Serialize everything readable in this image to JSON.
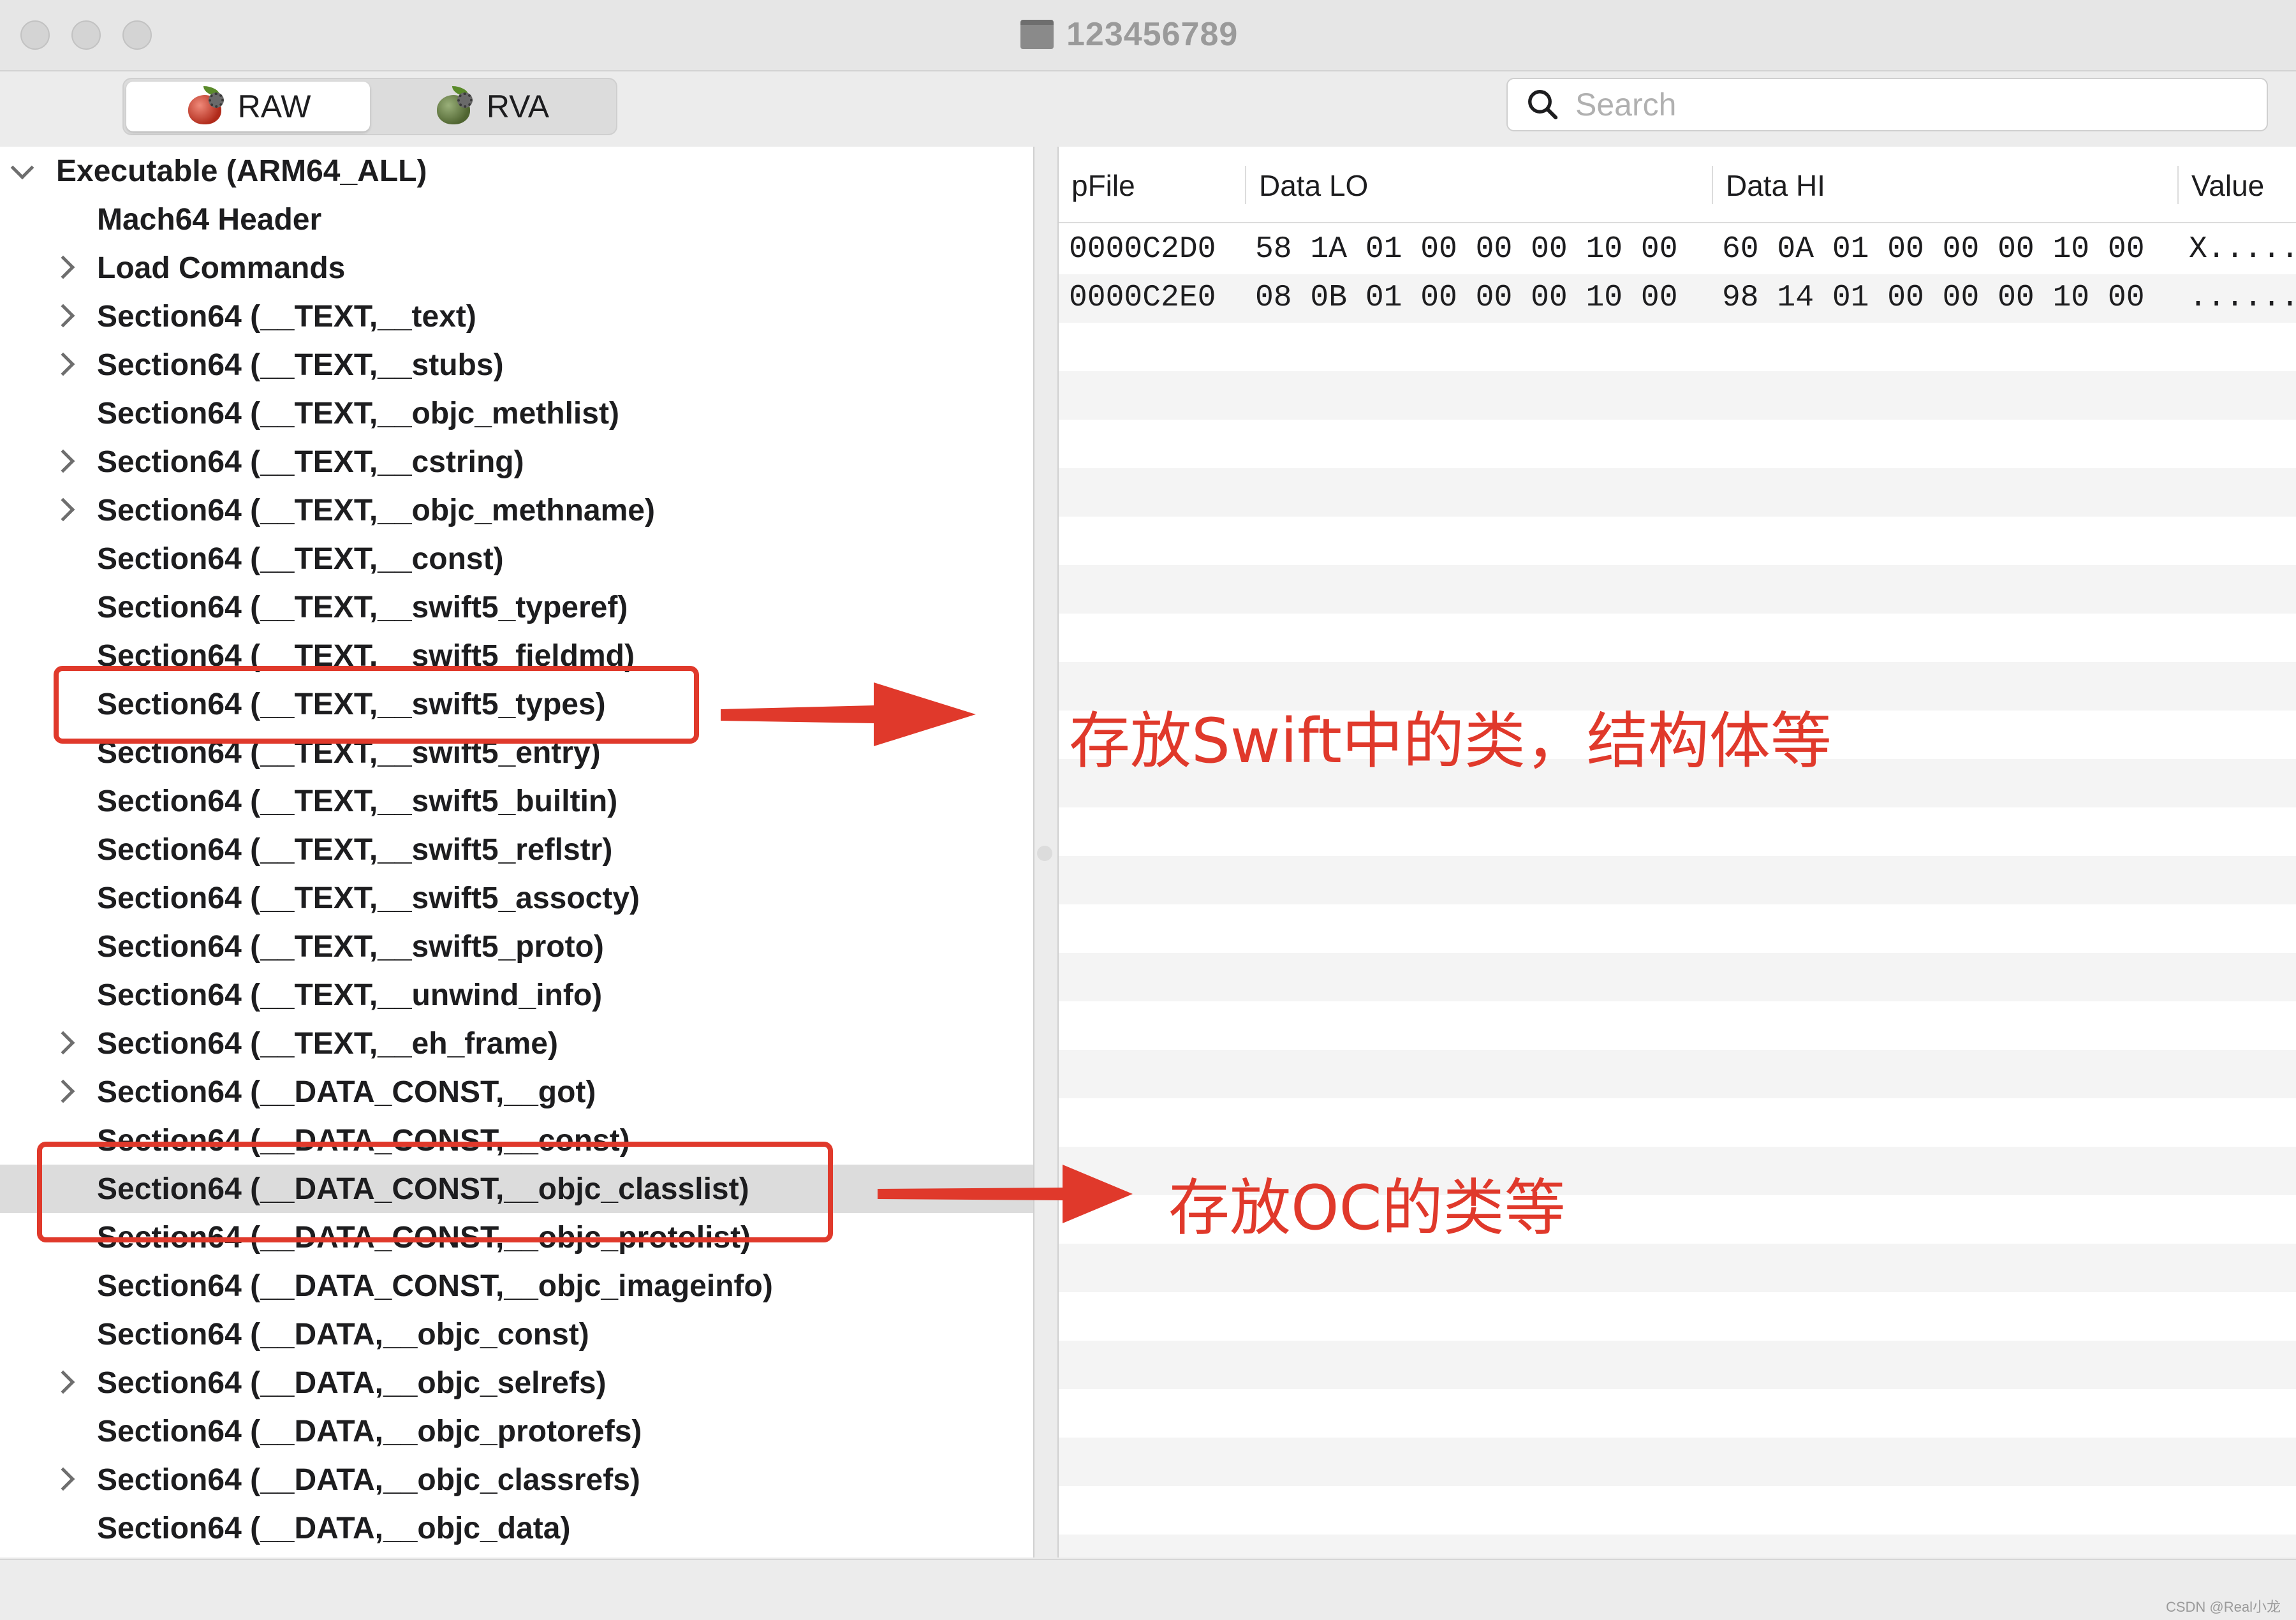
{
  "window": {
    "title": "123456789"
  },
  "toolbar": {
    "segments": [
      {
        "label": "RAW",
        "active": true,
        "icon": "red-apple-gear-icon"
      },
      {
        "label": "RVA",
        "active": false,
        "icon": "green-apple-gear-icon"
      }
    ],
    "search_placeholder": "Search"
  },
  "tree": {
    "items": [
      {
        "label": "Executable  (ARM64_ALL)",
        "level": 0,
        "chevron": "down"
      },
      {
        "label": "Mach64 Header",
        "level": 1,
        "chevron": "none"
      },
      {
        "label": "Load Commands",
        "level": 1,
        "chevron": "right"
      },
      {
        "label": "Section64 (__TEXT,__text)",
        "level": 1,
        "chevron": "right"
      },
      {
        "label": "Section64 (__TEXT,__stubs)",
        "level": 1,
        "chevron": "right"
      },
      {
        "label": "Section64 (__TEXT,__objc_methlist)",
        "level": 1,
        "chevron": "none"
      },
      {
        "label": "Section64 (__TEXT,__cstring)",
        "level": 1,
        "chevron": "right"
      },
      {
        "label": "Section64 (__TEXT,__objc_methname)",
        "level": 1,
        "chevron": "right"
      },
      {
        "label": "Section64 (__TEXT,__const)",
        "level": 1,
        "chevron": "none"
      },
      {
        "label": "Section64 (__TEXT,__swift5_typeref)",
        "level": 1,
        "chevron": "none"
      },
      {
        "label": "Section64 (__TEXT,__swift5_fieldmd)",
        "level": 1,
        "chevron": "none"
      },
      {
        "label": "Section64 (__TEXT,__swift5_types)",
        "level": 1,
        "chevron": "none"
      },
      {
        "label": "Section64 (__TEXT,__swift5_entry)",
        "level": 1,
        "chevron": "none"
      },
      {
        "label": "Section64 (__TEXT,__swift5_builtin)",
        "level": 1,
        "chevron": "none"
      },
      {
        "label": "Section64 (__TEXT,__swift5_reflstr)",
        "level": 1,
        "chevron": "none"
      },
      {
        "label": "Section64 (__TEXT,__swift5_assocty)",
        "level": 1,
        "chevron": "none"
      },
      {
        "label": "Section64 (__TEXT,__swift5_proto)",
        "level": 1,
        "chevron": "none"
      },
      {
        "label": "Section64 (__TEXT,__unwind_info)",
        "level": 1,
        "chevron": "none"
      },
      {
        "label": "Section64 (__TEXT,__eh_frame)",
        "level": 1,
        "chevron": "right"
      },
      {
        "label": "Section64 (__DATA_CONST,__got)",
        "level": 1,
        "chevron": "right"
      },
      {
        "label": "Section64 (__DATA_CONST,__const)",
        "level": 1,
        "chevron": "none"
      },
      {
        "label": "Section64 (__DATA_CONST,__objc_classlist)",
        "level": 1,
        "chevron": "none",
        "selected": true
      },
      {
        "label": "Section64 (__DATA_CONST,__objc_protolist)",
        "level": 1,
        "chevron": "none"
      },
      {
        "label": "Section64 (__DATA_CONST,__objc_imageinfo)",
        "level": 1,
        "chevron": "none"
      },
      {
        "label": "Section64 (__DATA,__objc_const)",
        "level": 1,
        "chevron": "none"
      },
      {
        "label": "Section64 (__DATA,__objc_selrefs)",
        "level": 1,
        "chevron": "right"
      },
      {
        "label": "Section64 (__DATA,__objc_protorefs)",
        "level": 1,
        "chevron": "none"
      },
      {
        "label": "Section64 (__DATA,__objc_classrefs)",
        "level": 1,
        "chevron": "right"
      },
      {
        "label": "Section64 (__DATA,__objc_data)",
        "level": 1,
        "chevron": "none"
      }
    ]
  },
  "hex_table": {
    "columns": [
      "pFile",
      "Data LO",
      "Data HI",
      "Value"
    ],
    "rows": [
      {
        "pFile": "0000C2D0",
        "data_lo": "58 1A 01 00 00 00 10 00",
        "data_hi": "60 0A 01 00 00 00 10 00",
        "value": "X....."
      },
      {
        "pFile": "0000C2E0",
        "data_lo": "08 0B 01 00 00 00 10 00",
        "data_hi": "98 14 01 00 00 00 10 00",
        "value": "......"
      }
    ]
  },
  "annotations": {
    "swift_note": "存放Swift中的类，结构体等",
    "oc_note": "存放OC的类等",
    "color": "#e0392b"
  },
  "watermark": "CSDN @Real小龙"
}
